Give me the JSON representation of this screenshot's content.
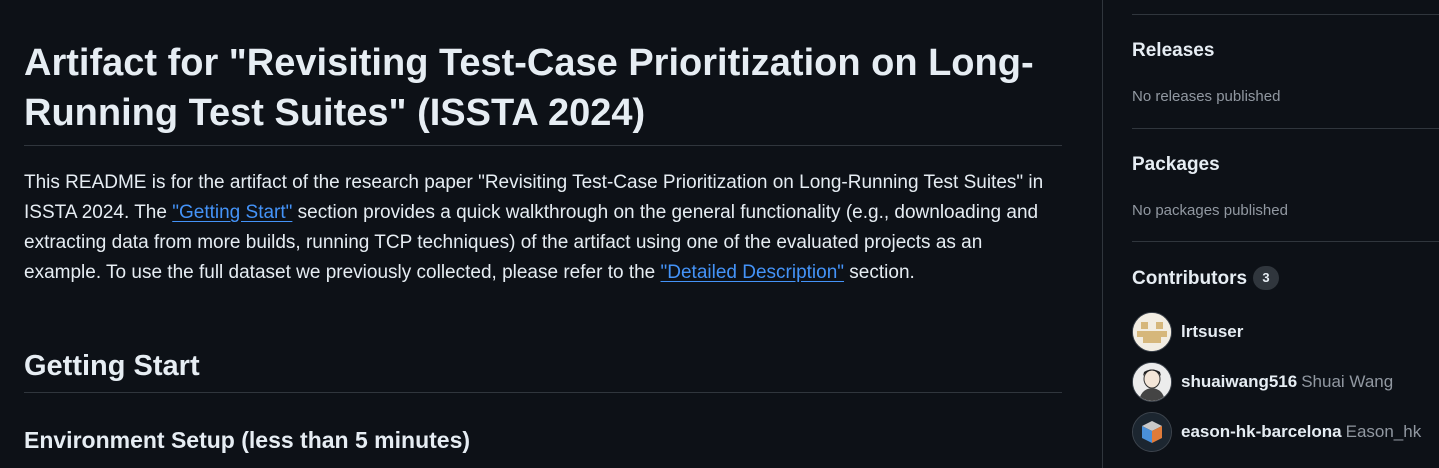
{
  "readme": {
    "title": "Artifact for \"Revisiting Test-Case Prioritization on Long-Running Test Suites\" (ISSTA 2024)",
    "intro_part1": "This README is for the artifact of the research paper \"Revisiting Test-Case Prioritization on Long-Running Test Suites\" in ISSTA 2024. The ",
    "link_getting_start": "\"Getting Start\"",
    "intro_part2": " section provides a quick walkthrough on the general functionality (e.g., downloading and extracting data from more builds, running TCP techniques) of the artifact using one of the evaluated projects as an example. To use the full dataset we previously collected, please refer to the ",
    "link_detailed_description": "\"Detailed Description\"",
    "intro_part3": " section.",
    "h2_getting_start": "Getting Start",
    "h3_environment_setup": "Environment Setup (less than 5 minutes)"
  },
  "sidebar": {
    "releases": {
      "title": "Releases",
      "empty": "No releases published"
    },
    "packages": {
      "title": "Packages",
      "empty": "No packages published"
    },
    "contributors": {
      "title": "Contributors",
      "count": "3",
      "items": [
        {
          "login": "lrtsuser",
          "name": ""
        },
        {
          "login": "shuaiwang516",
          "name": "Shuai Wang"
        },
        {
          "login": "eason-hk-barcelona",
          "name": "Eason_hk"
        }
      ]
    }
  },
  "colors": {
    "background": "#0d1117",
    "text": "#e6edf3",
    "muted": "#9198a1",
    "link": "#4493f8",
    "border": "#30363d"
  }
}
